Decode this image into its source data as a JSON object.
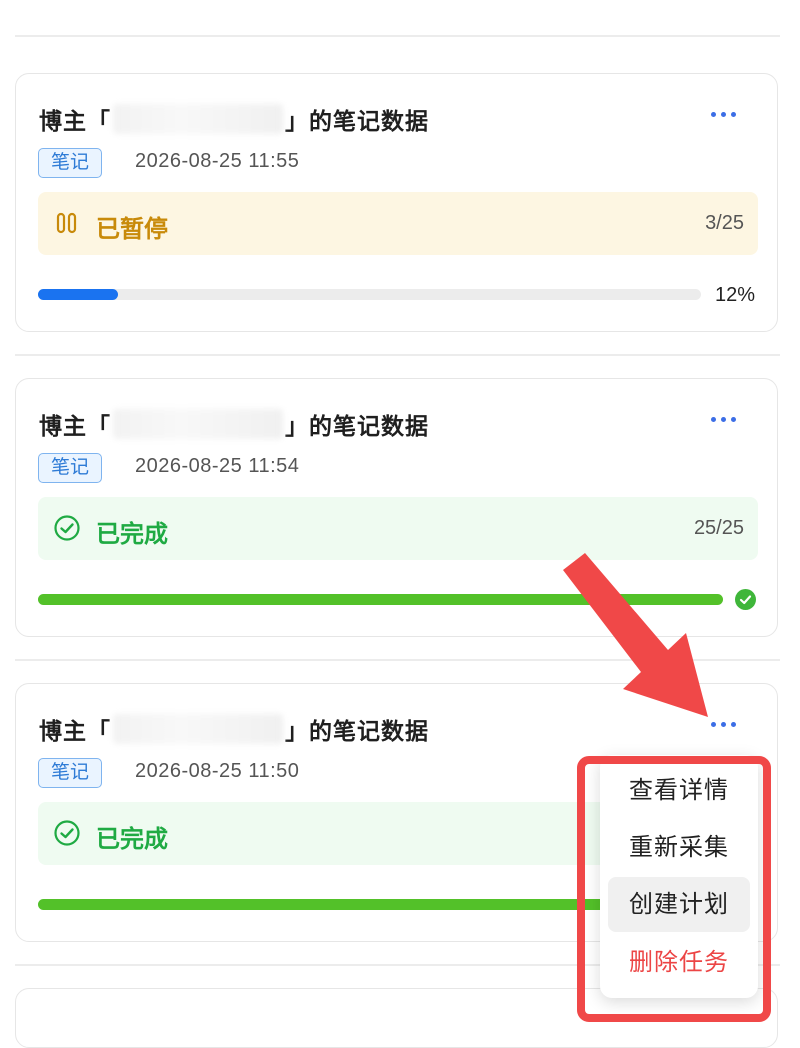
{
  "colors": {
    "accent_blue": "#3c6ee6",
    "paused_text": "#c88a0a",
    "paused_bg": "#fdf6e2",
    "done_text": "#1faa43",
    "done_bg": "#effbf1",
    "progress_blue": "#1a73f0",
    "progress_green": "#53c129",
    "danger": "#ec4545",
    "annotation_red": "#f04848"
  },
  "tasks": [
    {
      "title_prefix": "博主「",
      "title_suffix": "」的笔记数据",
      "tag": "笔记",
      "time": "2026-08-25 11:55",
      "status": "已暂停",
      "status_icon": "pause-icon",
      "count": "3/25",
      "progress": 0.12,
      "progress_label": "12%"
    },
    {
      "title_prefix": "博主「",
      "title_suffix": "」的笔记数据",
      "tag": "笔记",
      "time": "2026-08-25 11:54",
      "status": "已完成",
      "status_icon": "check-circle-icon",
      "count": "25/25",
      "progress": 1.0,
      "progress_label": ""
    },
    {
      "title_prefix": "博主「",
      "title_suffix": "」的笔记数据",
      "tag": "笔记",
      "time": "2026-08-25 11:50",
      "status": "已完成",
      "status_icon": "check-circle-icon",
      "count": "",
      "progress": 1.0,
      "progress_label": ""
    }
  ],
  "menu": {
    "items": [
      "查看详情",
      "重新采集",
      "创建计划",
      "删除任务"
    ],
    "highlighted": "创建计划",
    "danger_item": "删除任务"
  }
}
